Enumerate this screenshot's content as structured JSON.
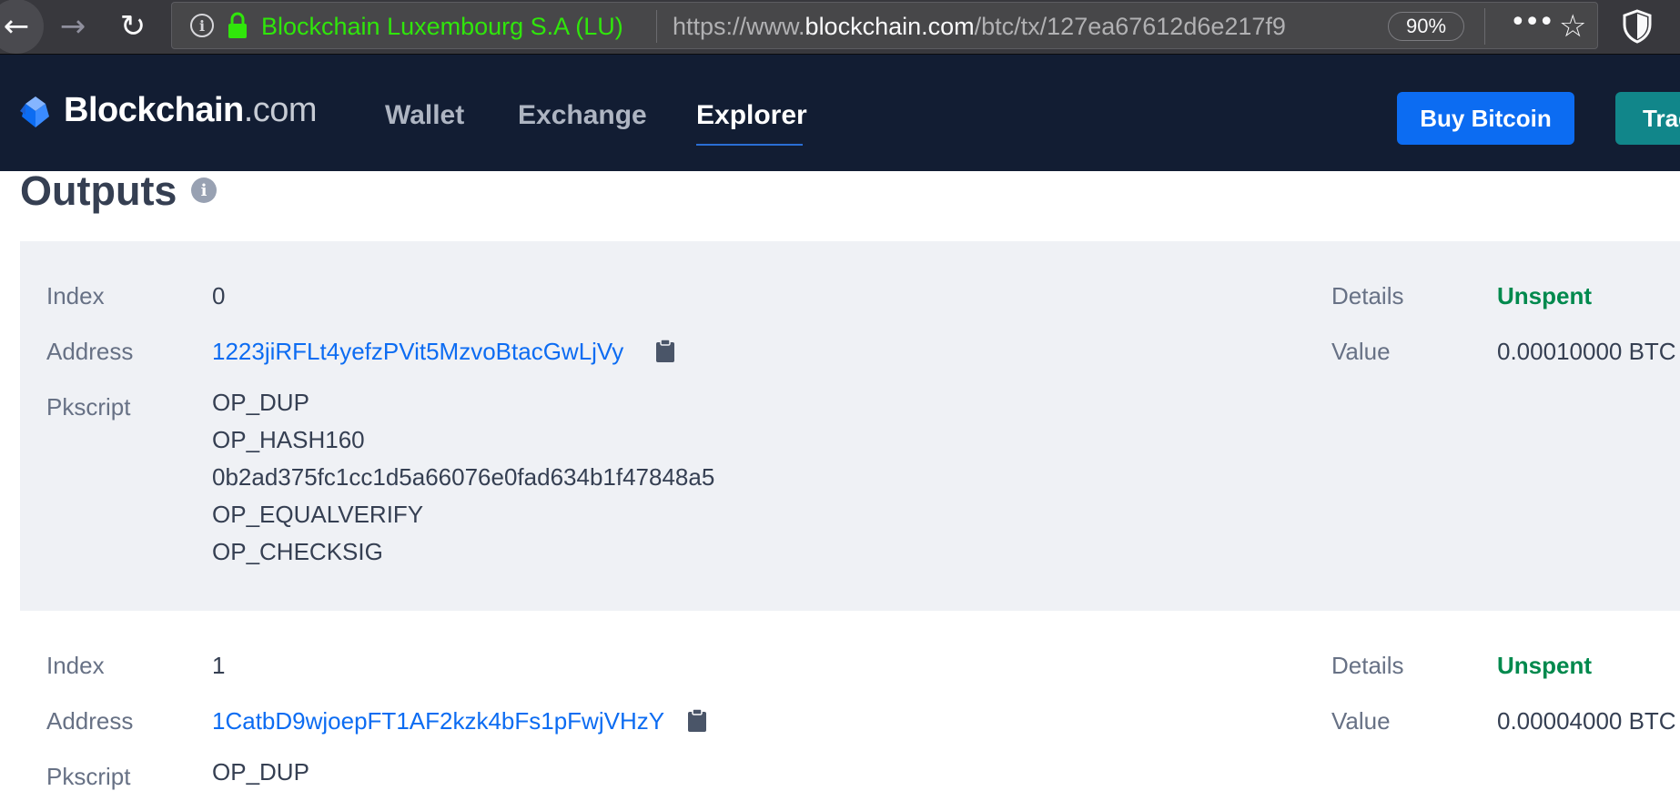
{
  "browser": {
    "back_glyph": "←",
    "forward_glyph": "→",
    "reload_glyph": "↻",
    "info_glyph": "i",
    "org_name": "Blockchain Luxembourg S.A (LU)",
    "url_prefix": "https://www.",
    "url_domain": "blockchain.com",
    "url_path": "/btc/tx/127ea67612d6e217f9",
    "zoom": "90%",
    "more_glyph": "•••",
    "star_glyph": "☆",
    "colors": {
      "org_green": "#30e60b",
      "chrome_bg": "#38383d"
    }
  },
  "header": {
    "logo_name": "Blockchain",
    "logo_domain": ".com",
    "nav": {
      "wallet": "Wallet",
      "exchange": "Exchange",
      "explorer": "Explorer"
    },
    "active_nav": "Explorer",
    "buy_button": "Buy Bitcoin",
    "trade_button": "Trad",
    "colors": {
      "header_bg": "#121d33",
      "buy_bg": "#0c6cf2",
      "trade_bg": "#11868a"
    }
  },
  "outputs": {
    "title": "Outputs",
    "info_glyph": "i",
    "items": [
      {
        "index_label": "Index",
        "index": "0",
        "address_label": "Address",
        "address": "1223jiRFLt4yefzPVit5MzvoBtacGwLjVy",
        "pkscript_label": "Pkscript",
        "pkscript": [
          "OP_DUP",
          "OP_HASH160",
          "0b2ad375fc1cc1d5a66076e0fad634b1f47848a5",
          "OP_EQUALVERIFY",
          "OP_CHECKSIG"
        ],
        "details_label": "Details",
        "details": "Unspent",
        "value_label": "Value",
        "value": "0.00010000 BTC"
      },
      {
        "index_label": "Index",
        "index": "1",
        "address_label": "Address",
        "address": "1CatbD9wjoepFT1AF2kzk4bFs1pFwjVHzY",
        "pkscript_label": "Pkscript",
        "pkscript": [
          "OP_DUP"
        ],
        "details_label": "Details",
        "details": "Unspent",
        "value_label": "Value",
        "value": "0.00004000 BTC"
      }
    ],
    "colors": {
      "card_bg": "#eff1f5",
      "link": "#0c6cf2",
      "unspent": "#00894d"
    }
  }
}
